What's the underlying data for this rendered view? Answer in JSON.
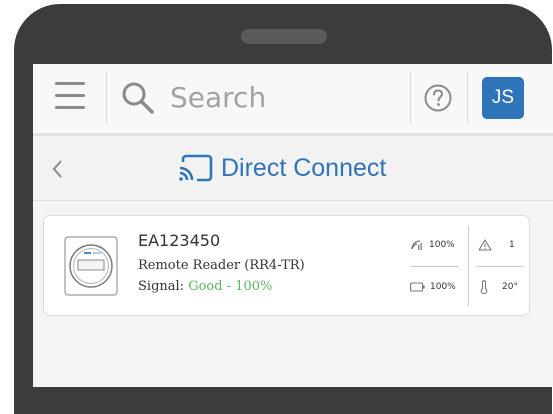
{
  "header": {
    "search": {
      "placeholder": "Search",
      "value": ""
    },
    "avatar_initials": "JS"
  },
  "subheader": {
    "title": "Direct Connect"
  },
  "device": {
    "id": "EA123450",
    "model": "Remote Reader (RR4-TR)",
    "signal_label": "Signal:",
    "signal_value": "Good - 100%",
    "stats": {
      "signal": "100%",
      "alerts": "1",
      "battery": "100%",
      "temperature": "20°"
    }
  },
  "colors": {
    "accent": "#2f73b9",
    "good": "#5cb85c",
    "frame": "#3c3c3c"
  }
}
